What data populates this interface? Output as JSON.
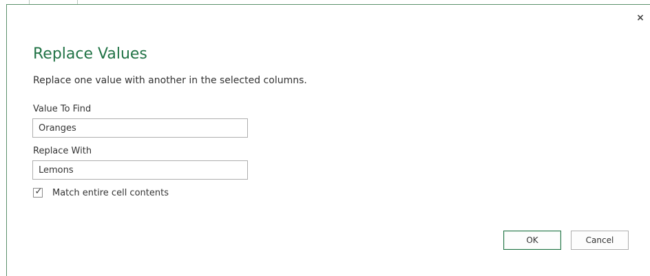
{
  "dialog": {
    "title": "Replace Values",
    "description": "Replace one value with another in the selected columns.",
    "close_glyph": "×"
  },
  "fields": {
    "find": {
      "label": "Value To Find",
      "value": "Oranges"
    },
    "replace": {
      "label": "Replace With",
      "value": "Lemons"
    }
  },
  "options": {
    "match_entire": {
      "label": "Match entire cell contents",
      "checked": true,
      "check_glyph": "✓"
    }
  },
  "buttons": {
    "ok": "OK",
    "cancel": "Cancel"
  },
  "colors": {
    "accent": "#217346",
    "frame": "#5a8f6a"
  }
}
